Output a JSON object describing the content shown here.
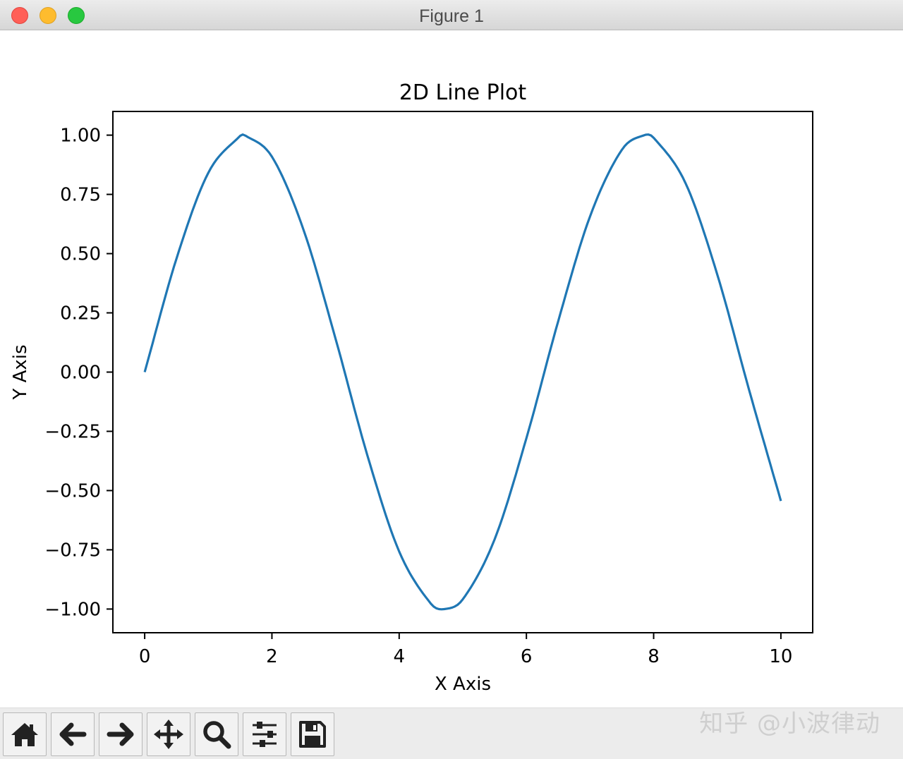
{
  "window": {
    "title": "Figure 1"
  },
  "toolbar": {
    "buttons": [
      {
        "name": "home-icon"
      },
      {
        "name": "arrow-left-icon"
      },
      {
        "name": "arrow-right-icon"
      },
      {
        "name": "move-icon"
      },
      {
        "name": "zoom-icon"
      },
      {
        "name": "sliders-icon"
      },
      {
        "name": "save-icon"
      }
    ]
  },
  "watermark": "知乎 @小波律动",
  "colors": {
    "line": "#1f77b4",
    "axes": "#000000"
  },
  "chart_data": {
    "type": "line",
    "title": "2D Line Plot",
    "xlabel": "X Axis",
    "ylabel": "Y Axis",
    "xlim": [
      -0.5,
      10.5
    ],
    "ylim": [
      -1.1,
      1.1
    ],
    "xticks": [
      0,
      2,
      4,
      6,
      8,
      10
    ],
    "xtick_labels": [
      "0",
      "2",
      "4",
      "6",
      "8",
      "10"
    ],
    "yticks": [
      -1.0,
      -0.75,
      -0.5,
      -0.25,
      0.0,
      0.25,
      0.5,
      0.75,
      1.0
    ],
    "ytick_labels": [
      "−1.00",
      "−0.75",
      "−0.50",
      "−0.25",
      "0.00",
      "0.25",
      "0.50",
      "0.75",
      "1.00"
    ],
    "grid": false,
    "series": [
      {
        "x": [
          0,
          0.5,
          1.0,
          1.5,
          1.5708,
          2.0,
          2.5,
          3.0,
          3.5,
          4.0,
          4.5,
          4.7124,
          5.0,
          5.5,
          6.0,
          6.5,
          7.0,
          7.5,
          7.854,
          8.0,
          8.5,
          9.0,
          9.5,
          10.0
        ],
        "y": [
          0.0,
          0.479,
          0.841,
          0.997,
          1.0,
          0.909,
          0.598,
          0.141,
          -0.351,
          -0.757,
          -0.978,
          -1.0,
          -0.959,
          -0.706,
          -0.279,
          0.215,
          0.657,
          0.938,
          1.0,
          0.989,
          0.798,
          0.412,
          -0.075,
          -0.544
        ]
      }
    ]
  }
}
